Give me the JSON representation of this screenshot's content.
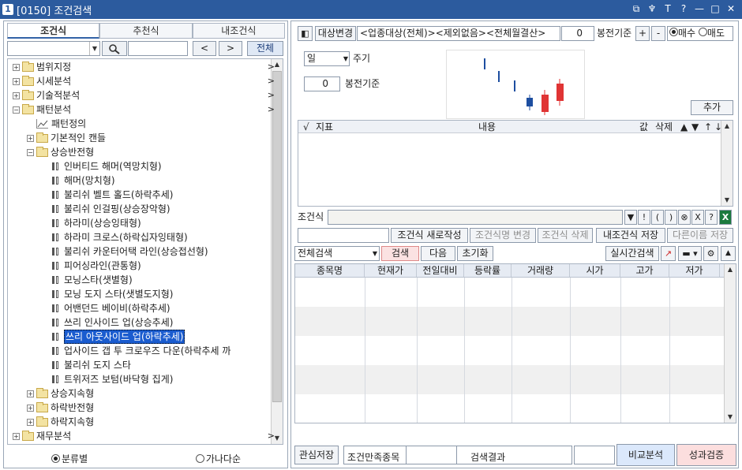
{
  "window": {
    "num": "1",
    "title": "[0150] 조건검색",
    "icons": [
      "restore-icon",
      "pin-icon",
      "text-icon",
      "help-icon",
      "minimize-icon",
      "maximize-icon",
      "close-icon"
    ],
    "icon_glyphs": [
      "⧉",
      "♆",
      "T",
      "?",
      "—",
      "□",
      "✕"
    ]
  },
  "left": {
    "tabs": [
      "조건식",
      "추천식",
      "내조건식"
    ],
    "prev": "<",
    "next": ">",
    "all": "전체",
    "tree": [
      {
        "label": "범위지정",
        "level": 0,
        "type": "folder",
        "exp": "+",
        "more": ">"
      },
      {
        "label": "시세분석",
        "level": 0,
        "type": "folder",
        "exp": "+",
        "more": ">"
      },
      {
        "label": "기술적분석",
        "level": 0,
        "type": "folder",
        "exp": "+",
        "more": ">"
      },
      {
        "label": "패턴분석",
        "level": 0,
        "type": "folder",
        "exp": "−",
        "more": ">"
      },
      {
        "label": "패턴정의",
        "level": 1,
        "type": "chart"
      },
      {
        "label": "기본적인 캔들",
        "level": 1,
        "type": "folder",
        "exp": "+"
      },
      {
        "label": "상승반전형",
        "level": 1,
        "type": "folder",
        "exp": "−"
      },
      {
        "label": "인버티드 해머(역망치형)",
        "level": 2,
        "type": "candle"
      },
      {
        "label": "해머(망치형)",
        "level": 2,
        "type": "candle"
      },
      {
        "label": "불리쉬 벨트 홀드(하락추세)",
        "level": 2,
        "type": "candle"
      },
      {
        "label": "불리쉬 인걸핑(상승장악형)",
        "level": 2,
        "type": "candle"
      },
      {
        "label": "하라미(상승잉태형)",
        "level": 2,
        "type": "candle"
      },
      {
        "label": "하라미 크로스(하락십자잉태형)",
        "level": 2,
        "type": "candle"
      },
      {
        "label": "불리쉬 카운터어택 라인(상승접선형)",
        "level": 2,
        "type": "candle"
      },
      {
        "label": "피어싱라인(관통형)",
        "level": 2,
        "type": "candle"
      },
      {
        "label": "모닝스타(샛별형)",
        "level": 2,
        "type": "candle"
      },
      {
        "label": "모닝 도지 스타(샛별도지형)",
        "level": 2,
        "type": "candle"
      },
      {
        "label": "어밴던드 베이비(하락추세)",
        "level": 2,
        "type": "candle"
      },
      {
        "label": "쓰리 인사이드 업(상승추세)",
        "level": 2,
        "type": "candle"
      },
      {
        "label": "쓰리 아웃사이드 업(하락추세)",
        "level": 2,
        "type": "candle",
        "selected": true
      },
      {
        "label": "업사이드 갭 투 크로우즈 다운(하락추세 까",
        "level": 2,
        "type": "candle"
      },
      {
        "label": "불리쉬 도지 스타",
        "level": 2,
        "type": "candle"
      },
      {
        "label": "트위저즈 보텀(바닥형 집게)",
        "level": 2,
        "type": "candle"
      },
      {
        "label": "상승지속형",
        "level": 1,
        "type": "folder",
        "exp": "+"
      },
      {
        "label": "하락반전형",
        "level": 1,
        "type": "folder",
        "exp": "+"
      },
      {
        "label": "하락지속형",
        "level": 1,
        "type": "folder",
        "exp": "+"
      },
      {
        "label": "재무분석",
        "level": 0,
        "type": "folder",
        "exp": "+",
        "more": ">"
      }
    ],
    "radio": [
      "분류별",
      "가나다순"
    ]
  },
  "right": {
    "target_btn": "대상변경",
    "target_text": "<업종대상(전체)><제외없음><전체월결산>",
    "bars_value": "0",
    "bars_label": "봉전기준",
    "plus": "+",
    "minus": "-",
    "buy": "매수",
    "sell": "매도",
    "period_value": "일",
    "period_label": "주기",
    "bar_value2": "0",
    "bar_label2": "봉전기준",
    "add_btn": "추가",
    "cond_cols": [
      "√",
      "지표",
      "내용",
      "값",
      "삭제",
      "▲",
      "▼",
      "↑",
      "↓"
    ],
    "cond_label": "조건식",
    "cond_tools": [
      "▼",
      "!",
      "(",
      ")",
      "⊗",
      "X",
      "?"
    ],
    "btn_new": "조건식 새로작성",
    "btn_rename": "조건식명 변경",
    "btn_delete": "조건식 삭제",
    "btn_save": "내조건식 저장",
    "btn_saveas": "다른이름 저장",
    "scope": "전체검색",
    "search": "검색",
    "next": "다음",
    "reset": "초기화",
    "realtime": "실시간검색",
    "res_cols": [
      "종목명",
      "현재가",
      "전일대비",
      "등락률",
      "거래량",
      "시가",
      "고가",
      "저가"
    ],
    "bottom": {
      "fav": "관심저장",
      "cond_stock": "조건만족종목",
      "result": "검색결과",
      "compare": "비교분석",
      "verify": "성과검증"
    }
  },
  "colors": {
    "title": "#2c5b9e",
    "selection": "#1a5ccf",
    "candle_up": "#e03434",
    "candle_down": "#1d4ea0"
  }
}
